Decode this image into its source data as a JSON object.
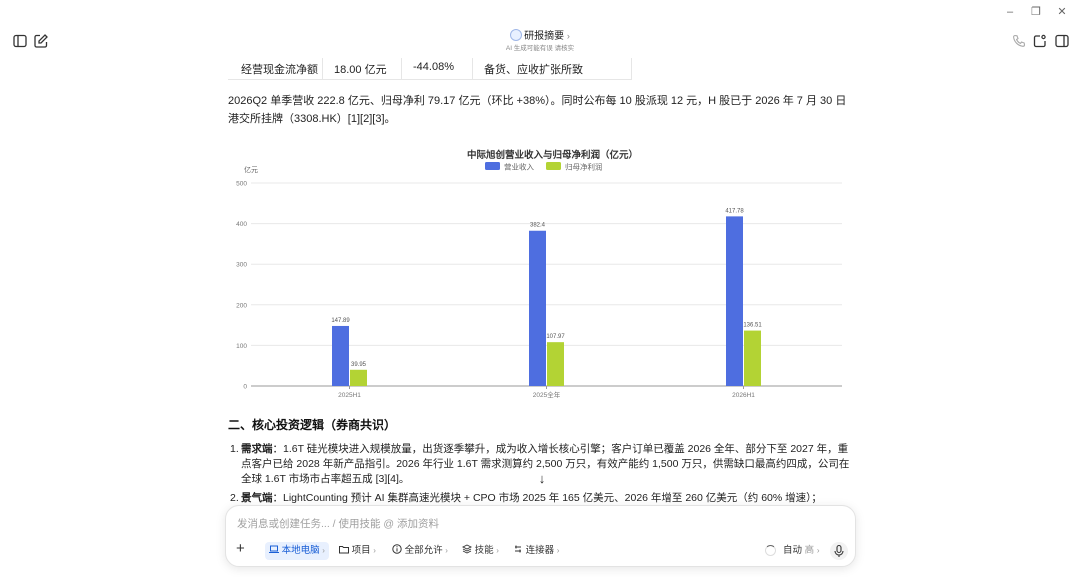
{
  "toolbar": {
    "title": "研报摘要",
    "subtitle": "AI 生成可能有误 请核实"
  },
  "table": {
    "row": [
      "经营现金流净额",
      "18.00 亿元",
      "-44.08%",
      "备货、应收扩张所致"
    ]
  },
  "paragraph": "2026Q2 单季营收 222.8 亿元、归母净利 79.17 亿元（环比 +38%）。同时公布每 10 股派现 12 元，H 股已于 2026 年 7 月 30 日港交所挂牌（3308.HK）[1][2][3]。",
  "chart_data": {
    "type": "bar",
    "title": "中际旭创营业收入与归母净利润（亿元）",
    "ylabel": "亿元",
    "categories": [
      "2025H1",
      "2025全年",
      "2026H1"
    ],
    "series": [
      {
        "name": "营业收入",
        "values": [
          147.89,
          382.4,
          417.78
        ],
        "color": "#4e6ee0"
      },
      {
        "name": "归母净利润",
        "values": [
          39.95,
          107.97,
          136.51
        ],
        "color": "#b3d334"
      }
    ],
    "ylim": [
      0,
      500
    ],
    "yticks": [
      0,
      100,
      200,
      300,
      400,
      500
    ],
    "value_labels": [
      [
        "147.89",
        "382.4",
        "417.78"
      ],
      [
        "39.95",
        "107.97",
        "136.51"
      ]
    ],
    "grid": true,
    "legend": "top-center"
  },
  "section": {
    "heading": "二、核心投资逻辑（券商共识）",
    "items": [
      {
        "num": "1.",
        "label": "需求端",
        "text": "：1.6T 硅光模块进入规模放量，出货逐季攀升，成为收入增长核心引擎；客户订单已覆盖 2026 全年、部分下至 2027 年，重点客户已给 2028 年新产品指引。2026 年行业 1.6T 需求测算约 2,500 万只，有效产能约 1,500 万只，供需缺口最高约四成，公司在全球 1.6T 市场市占率超五成 [3][4]。"
      },
      {
        "num": "2.",
        "label": "景气端",
        "text": "：LightCounting 预计 AI 集群高速光模块 + CPO 市场 2025 年 165 亿美元、2026 年增至 260 亿美元（约 60% 增速）；"
      }
    ]
  },
  "composer": {
    "placeholder": "发消息或创建任务... / 使用技能 @ 添加资料",
    "chips": [
      "本地电脑",
      "项目",
      "全部允许",
      "技能",
      "连接器"
    ],
    "mode": "自动",
    "mode_sub": "高"
  }
}
